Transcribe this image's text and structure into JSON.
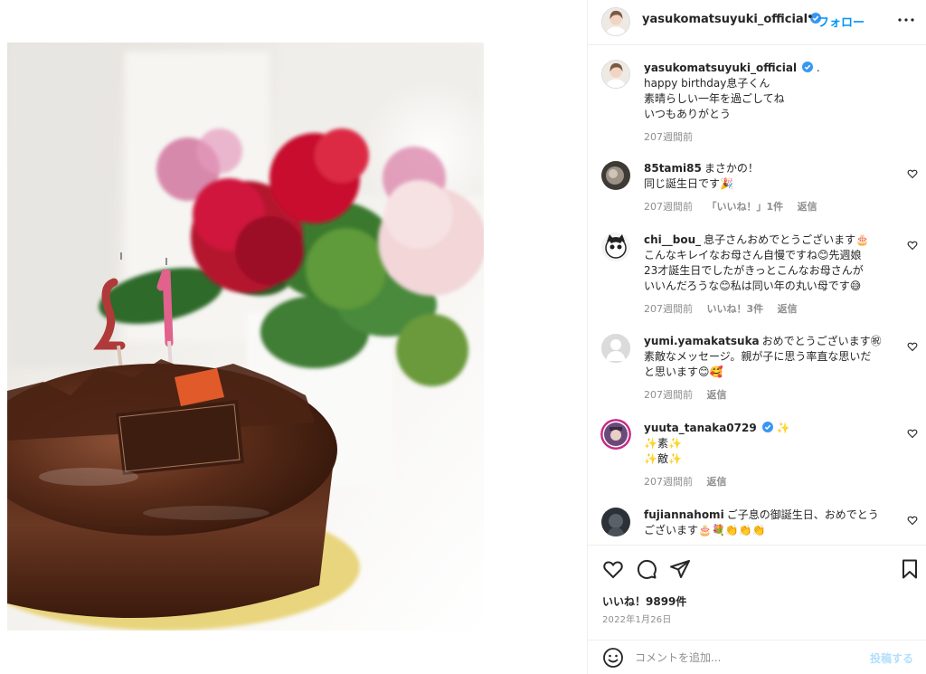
{
  "post": {
    "image_alt": "",
    "author": "yasukomatsuyuki_official",
    "follow_label": "フォロー",
    "separator": "•",
    "caption": {
      "user": "yasukomatsuyuki_official",
      "trail": ".",
      "lines": [
        "happy birthday息子くん",
        "素晴らしい一年を過ごしてね",
        "いつもありがとう"
      ],
      "time": "207週間前"
    },
    "candles_text": "21",
    "likes": "いいね！9899件",
    "date": "2022年1月26日"
  },
  "comments": [
    {
      "user": "85tami85",
      "text": "まさかの！",
      "lines": [
        "同じ誕生日です🎉"
      ],
      "time": "207週間前",
      "likes": "「いいね！」1件",
      "reply": "返信"
    },
    {
      "user": "chi__bou_",
      "text": "息子さんおめでとうございます🎂",
      "lines": [
        "こんなキレイなお母さん自慢ですね😊先週娘",
        "23才誕生日でしたがきっとこんなお母さんが",
        "いいんだろうな😊私は同い年の丸い母です😅"
      ],
      "time": "207週間前",
      "likes": "いいね！3件",
      "reply": "返信"
    },
    {
      "user": "yumi.yamakatsuka",
      "text": "おめでとうございます㊗",
      "lines": [
        "素敵なメッセージ。親が子に思う率直な思いだ",
        "と思います😊🥰"
      ],
      "time": "207週間前",
      "reply": "返信"
    },
    {
      "user": "yuuta_tanaka0729",
      "text": "✨",
      "lines": [
        "✨素✨",
        "✨敵✨"
      ],
      "time": "207週間前",
      "reply": "返信"
    },
    {
      "user": "fujiannahomi",
      "text": "ご子息の御誕生日、おめでとう",
      "lines": [
        "ございます🎂💐👏👏👏"
      ]
    }
  ],
  "composer": {
    "placeholder": "コメントを追加...",
    "post_label": "投稿する"
  },
  "icons": {
    "heart": "heart-icon",
    "comment": "comment-icon",
    "share": "share-icon",
    "save": "bookmark-icon",
    "more": "more-icon",
    "verified": "verified-badge-icon",
    "emoji": "emoji-icon"
  },
  "colors": {
    "accent": "#0095f6",
    "verified": "#3897f0",
    "muted": "#8e8e8e",
    "post_disabled": "#b2dffc"
  }
}
